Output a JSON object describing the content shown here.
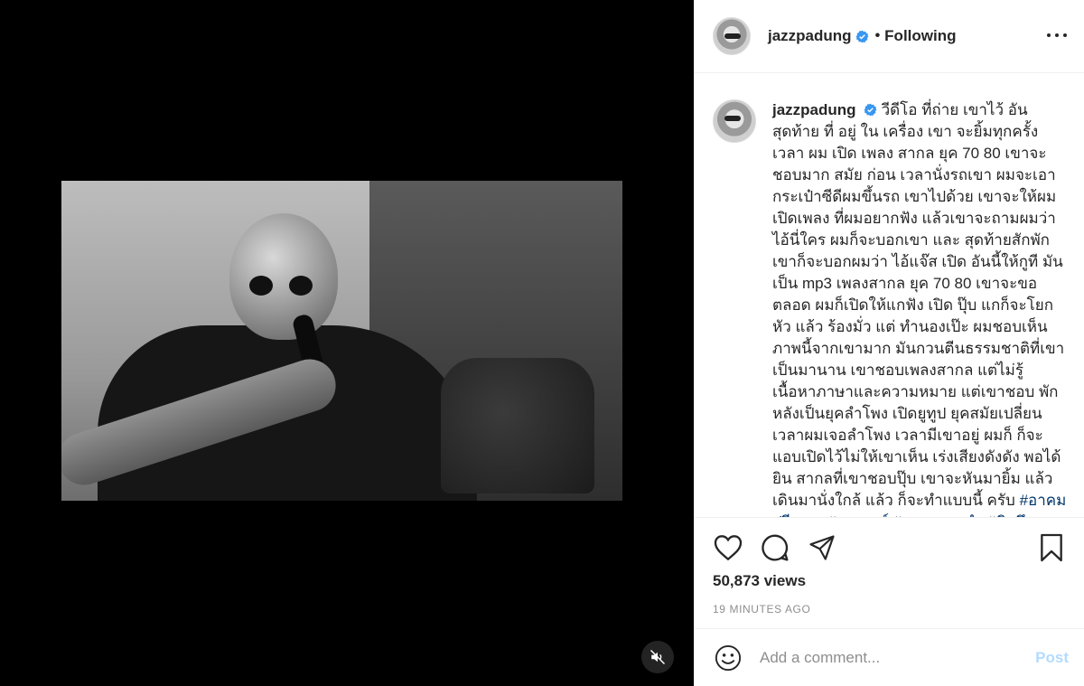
{
  "post": {
    "username": "jazzpadung",
    "verified": true,
    "follow_status": "Following",
    "separator": "•",
    "caption": "วีดีโอ ที่ถ่าย เขาไว้ อัน สุดท้าย ที่ อยู่ ใน เครื่อง เขา จะยิ้มทุกครั้ง เวลา ผม เปิด เพลง สากล ยุค 70 80 เขาจะชอบมาก สมัย ก่อน เวลานั่งรถเขา ผมจะเอากระเป๋าซีดีผมขึ้นรถ เขาไปด้วย เขาจะให้ผมเปิดเพลง ที่ผมอยากฟัง แล้วเขาจะถามผมว่า ไอ้นี่ใคร ผมก็จะบอกเขา และ สุดท้ายสักพักเขาก็จะบอกผมว่า ไอ้แจ๊ส เปิด อันนี้ให้กูที มันเป็น mp3 เพลงสากล ยุค 70 80 เขาจะขอตลอด ผมก็เปิดให้แกฟัง เปิด ปุ๊บ แกก็จะโยกหัว แล้ว ร้องมั่ว แต่ ทำนองเป๊ะ ผมชอบเห็นภาพนี้จากเขามาก มันกวนตีนธรรมชาติที่เขาเป็นมานาน เขาชอบเพลงสากล แต่ไม่รู้ เนื้อหาภาษาและความหมาย แต่เขาชอบ พักหลังเป็นยุคลำโพง เปิดยูทูป ยุคสมัยเปลี่ยน เวลาผมเจอลำโพง เวลามีเขาอยู่ ผมก็ ก็จะแอบเปิดไว้ไม่ให้เขาเห็น เร่งเสียงดังดัง พอได้ยิน สากลที่เขาชอบปุ๊บ เขาจะหันมายิ้ม แล้วเดินมานั่งใกล้ แล้ว ก็จะทำแบบนี้ ครับ",
    "hashtags": "#อาคมปรีดากุล#อาจารย์ #ความทรงจำ #คิดถึง #ใจหาย",
    "views": "50,873 views",
    "timestamp": "19 MINUTES AGO"
  },
  "comment": {
    "placeholder": "Add a comment...",
    "post_label": "Post"
  },
  "icons": {
    "verified": "verified-badge-icon",
    "more": "more-options-icon",
    "like": "heart-icon",
    "comment": "comment-icon",
    "share": "paper-plane-icon",
    "save": "bookmark-icon",
    "emoji": "emoji-icon",
    "mute": "muted-speaker-icon"
  },
  "colors": {
    "verified": "#3897f0",
    "hashtag": "#00376b",
    "post_disabled": "#b3dbff",
    "muted_text": "#8e8e8e"
  }
}
